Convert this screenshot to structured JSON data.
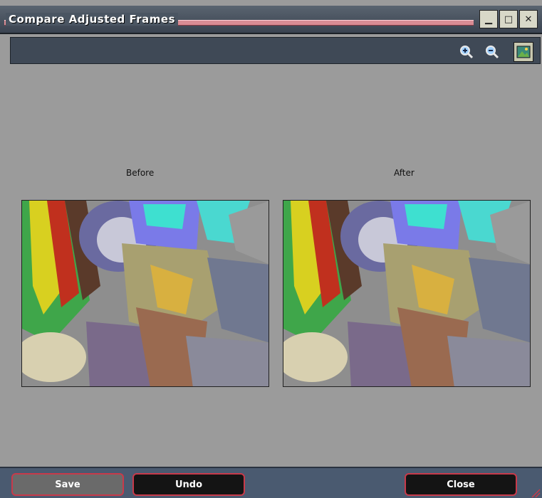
{
  "window": {
    "title": "Compare Adjusted Frames",
    "buttons": {
      "minimize": "▁",
      "maximize": "□",
      "close": "✕"
    }
  },
  "toolbar": {
    "zoom_in_icon": "zoom-in-icon",
    "zoom_out_icon": "zoom-out-icon",
    "fit_icon": "fit-to-window-icon"
  },
  "panels": {
    "before_label": "Before",
    "after_label": "After"
  },
  "footer": {
    "save_label": "Save",
    "undo_label": "Undo",
    "close_label": "Close"
  },
  "colors": {
    "accent": "#c83a4a",
    "titlebar": "#4a5562",
    "background": "#9b9b9b"
  }
}
